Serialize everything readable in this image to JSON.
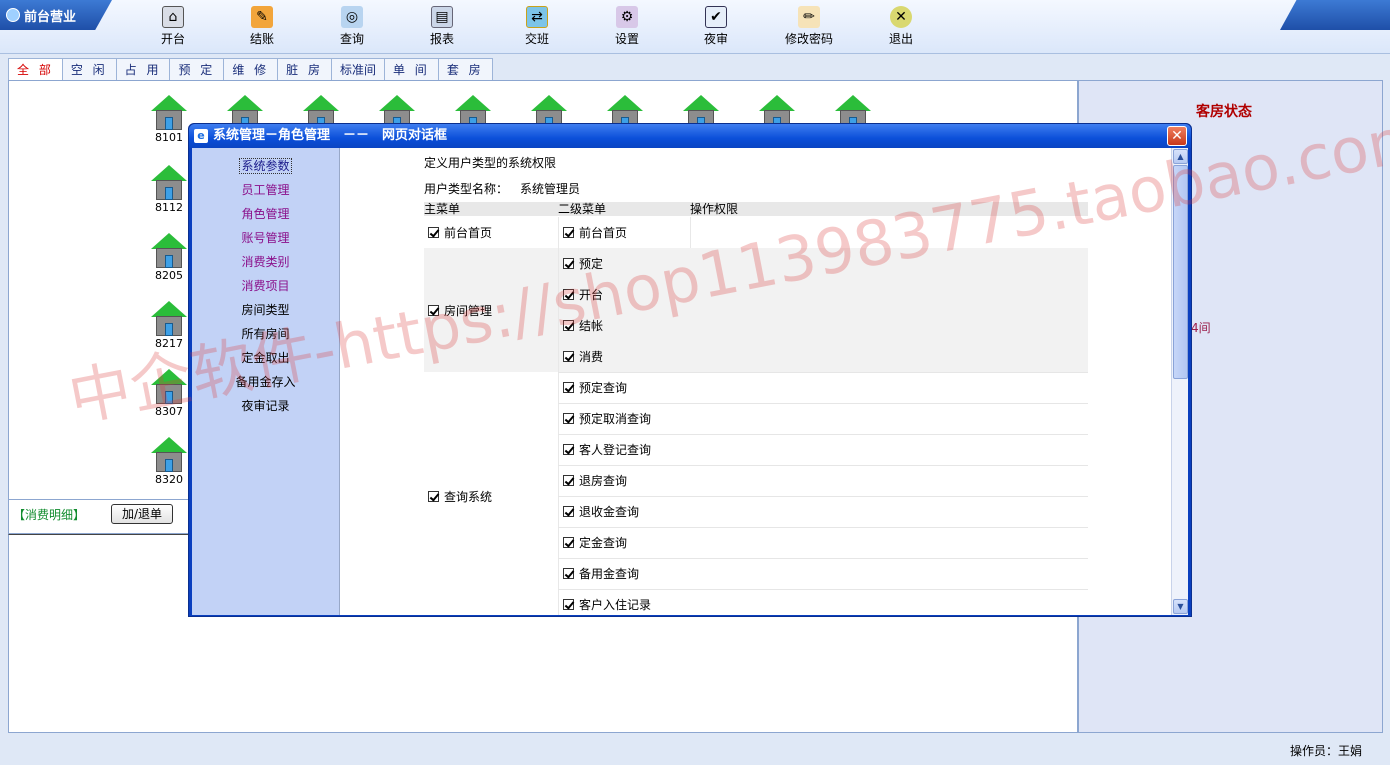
{
  "app": {
    "brand_title": "前台营业",
    "operator_text": "操作员：王娟"
  },
  "toolbar": {
    "buttons": [
      {
        "label": "开台",
        "icon": "open-table-icon"
      },
      {
        "label": "结账",
        "icon": "checkout-icon"
      },
      {
        "label": "查询",
        "icon": "query-icon"
      },
      {
        "label": "报表",
        "icon": "report-icon"
      },
      {
        "label": "交班",
        "icon": "shift-handover-icon"
      },
      {
        "label": "设置",
        "icon": "settings-icon"
      },
      {
        "label": "夜审",
        "icon": "night-audit-icon"
      },
      {
        "label": "修改密码",
        "icon": "change-password-icon"
      },
      {
        "label": "退出",
        "icon": "exit-icon"
      }
    ]
  },
  "tabs": [
    "全 部",
    "空 闲",
    "占 用",
    "预 定",
    "维 修",
    "脏 房",
    "标准间",
    "单 间",
    "套 房"
  ],
  "rooms": [
    "8101",
    "8112",
    "8205",
    "8217",
    "8307",
    "8320"
  ],
  "detail": {
    "label": "【消费明细】",
    "add_button": "加/退单"
  },
  "right_panel": {
    "title": "客房状态",
    "partial_text": "4间"
  },
  "dialog": {
    "title": "系统管理－角色管理　－－　网页对话框",
    "close": "✕",
    "nav": [
      {
        "label": "系统参数",
        "color": "blue",
        "current": true
      },
      {
        "label": "员工管理",
        "color": "purple"
      },
      {
        "label": "角色管理",
        "color": "purple"
      },
      {
        "label": "账号管理",
        "color": "purple"
      },
      {
        "label": "消费类别",
        "color": "purple"
      },
      {
        "label": "消费项目",
        "color": "purple"
      },
      {
        "label": "房间类型",
        "color": "black"
      },
      {
        "label": "所有房间",
        "color": "black"
      },
      {
        "label": "定金取出",
        "color": "black"
      },
      {
        "label": "备用金存入",
        "color": "black"
      },
      {
        "label": "夜审记录",
        "color": "black"
      }
    ],
    "heading": "定义用户类型的系统权限",
    "role_label": "用户类型名称：",
    "role_value": "系统管理员",
    "table_headers": [
      "主菜单",
      "二级菜单",
      "操作权限"
    ],
    "groups": [
      {
        "main": "前台首页",
        "subs": [
          "前台首页"
        ]
      },
      {
        "main": "房间管理",
        "subs": [
          "预定",
          "开台",
          "结帐",
          "消费"
        ]
      },
      {
        "main": "查询系统",
        "subs": [
          "预定查询",
          "预定取消查询",
          "客人登记查询",
          "退房查询",
          "退收金查询",
          "定金查询",
          "备用金查询",
          "客户入住记录"
        ]
      }
    ]
  },
  "watermark": "中企软件-https://shop113983775.taobao.com"
}
